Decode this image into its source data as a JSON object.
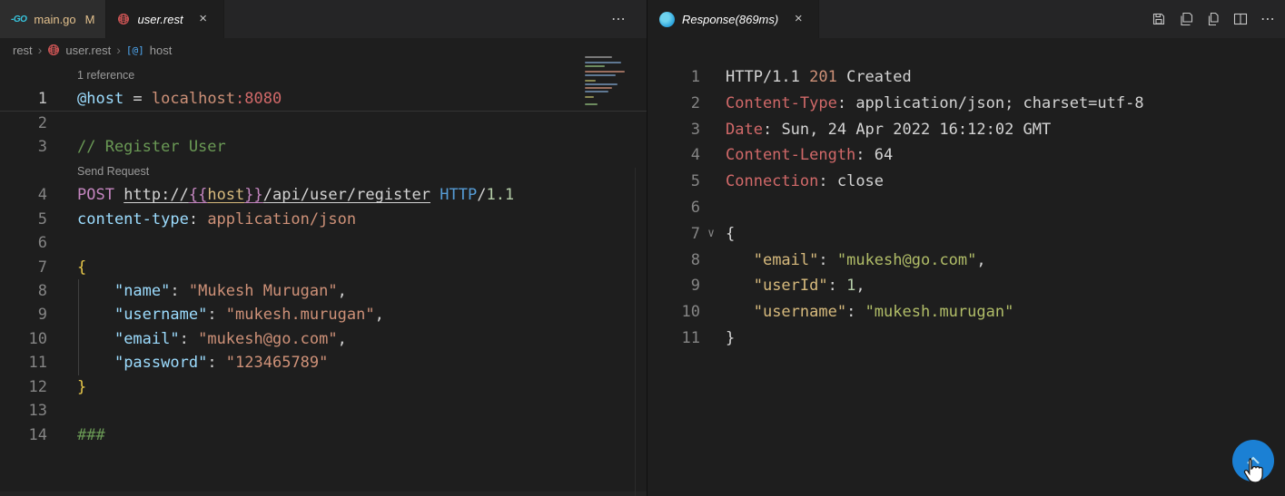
{
  "icons": {
    "go": "-GO",
    "close": "×",
    "more": "⋯",
    "fold": "∨",
    "symbol": "[@]",
    "separator": "›"
  },
  "colors": {
    "scroll_button_blue": "#1b80d4",
    "modified_tab_text": "#e2c08d",
    "globe_red": "#d05656",
    "go_cyan": "#38c7e0",
    "response_icon_blue": "#2ba3dd",
    "status_201": "#ce9178"
  },
  "left_pane": {
    "tabs": [
      {
        "label": "main.go",
        "badge": "M"
      },
      {
        "label": "user.rest"
      }
    ],
    "breadcrumb": {
      "separator": "›",
      "items": [
        {
          "label": "rest"
        },
        {
          "label": "user.rest"
        },
        {
          "label": "host"
        }
      ]
    },
    "editor_rows": [
      {
        "type": "lens",
        "text": "1 reference"
      },
      {
        "type": "code",
        "n": "1",
        "active": true,
        "seg": [
          [
            "@host",
            "blue"
          ],
          [
            " = ",
            "white"
          ],
          [
            "localhost",
            "orange"
          ],
          [
            ":8080",
            "red"
          ]
        ]
      },
      {
        "type": "code",
        "n": "2",
        "seg": []
      },
      {
        "type": "code",
        "n": "3",
        "seg": [
          [
            "// Register User",
            "green"
          ]
        ]
      },
      {
        "type": "lens",
        "text": "Send Request"
      },
      {
        "type": "code",
        "n": "4",
        "seg": [
          [
            "POST ",
            "pink"
          ],
          [
            "http://",
            "white u"
          ],
          [
            "{{",
            "pink u"
          ],
          [
            "host",
            "gold u"
          ],
          [
            "}}",
            "pink u"
          ],
          [
            "/api/user/register",
            "white u"
          ],
          [
            " ",
            "white"
          ],
          [
            "HTTP",
            "kwblue"
          ],
          [
            "/",
            "white"
          ],
          [
            "1.1",
            "lgreen"
          ]
        ]
      },
      {
        "type": "code",
        "n": "5",
        "seg": [
          [
            "content-type",
            "blue"
          ],
          [
            ": ",
            "white"
          ],
          [
            "application/json",
            "orange"
          ]
        ]
      },
      {
        "type": "code",
        "n": "6",
        "seg": []
      },
      {
        "type": "code",
        "n": "7",
        "seg": [
          [
            "{",
            "yellow"
          ]
        ]
      },
      {
        "type": "code",
        "n": "8",
        "guide": true,
        "seg": [
          [
            "    ",
            "white"
          ],
          [
            "\"name\"",
            "blue"
          ],
          [
            ": ",
            "white"
          ],
          [
            "\"Mukesh Murugan\"",
            "orange"
          ],
          [
            ",",
            "white"
          ]
        ]
      },
      {
        "type": "code",
        "n": "9",
        "guide": true,
        "seg": [
          [
            "    ",
            "white"
          ],
          [
            "\"username\"",
            "blue"
          ],
          [
            ": ",
            "white"
          ],
          [
            "\"mukesh.murugan\"",
            "orange"
          ],
          [
            ",",
            "white"
          ]
        ]
      },
      {
        "type": "code",
        "n": "10",
        "guide": true,
        "seg": [
          [
            "    ",
            "white"
          ],
          [
            "\"email\"",
            "blue"
          ],
          [
            ": ",
            "white"
          ],
          [
            "\"mukesh@go.com\"",
            "orange"
          ],
          [
            ",",
            "white"
          ]
        ]
      },
      {
        "type": "code",
        "n": "11",
        "guide": true,
        "seg": [
          [
            "    ",
            "white"
          ],
          [
            "\"password\"",
            "blue"
          ],
          [
            ": ",
            "white"
          ],
          [
            "\"123465789\"",
            "orange"
          ]
        ]
      },
      {
        "type": "code",
        "n": "12",
        "seg": [
          [
            "}",
            "yellow"
          ]
        ]
      },
      {
        "type": "code",
        "n": "13",
        "seg": []
      },
      {
        "type": "code",
        "n": "14",
        "seg": [
          [
            "###",
            "green"
          ]
        ]
      }
    ]
  },
  "right_pane": {
    "tab": {
      "label": "Response(869ms)"
    },
    "actions": [
      {
        "name": "save-response"
      },
      {
        "name": "save-response-body"
      },
      {
        "name": "copy-response"
      },
      {
        "name": "split-editor"
      },
      {
        "name": "more-actions"
      }
    ],
    "editor_rows": [
      {
        "type": "code",
        "n": "1",
        "seg": [
          [
            "HTTP/1.1 ",
            "white"
          ],
          [
            "201",
            "orange"
          ],
          [
            " Created",
            "white"
          ]
        ]
      },
      {
        "type": "code",
        "n": "2",
        "seg": [
          [
            "Content-Type",
            "red"
          ],
          [
            ": ",
            "white"
          ],
          [
            "application/json; charset=utf-8",
            "white"
          ]
        ]
      },
      {
        "type": "code",
        "n": "3",
        "seg": [
          [
            "Date",
            "red"
          ],
          [
            ": ",
            "white"
          ],
          [
            "Sun, 24 Apr 2022 16:12:02 GMT",
            "white"
          ]
        ]
      },
      {
        "type": "code",
        "n": "4",
        "seg": [
          [
            "Content-Length",
            "red"
          ],
          [
            ": ",
            "white"
          ],
          [
            "64",
            "white"
          ]
        ]
      },
      {
        "type": "code",
        "n": "5",
        "seg": [
          [
            "Connection",
            "red"
          ],
          [
            ": ",
            "white"
          ],
          [
            "close",
            "white"
          ]
        ]
      },
      {
        "type": "code",
        "n": "6",
        "seg": []
      },
      {
        "type": "code",
        "n": "7",
        "fold": true,
        "seg": [
          [
            "{",
            "white"
          ]
        ]
      },
      {
        "type": "code",
        "n": "8",
        "seg": [
          [
            "   ",
            "white"
          ],
          [
            "\"email\"",
            "gold"
          ],
          [
            ": ",
            "white"
          ],
          [
            "\"mukesh@go.com\"",
            "olive"
          ],
          [
            ",",
            "white"
          ]
        ]
      },
      {
        "type": "code",
        "n": "9",
        "seg": [
          [
            "   ",
            "white"
          ],
          [
            "\"userId\"",
            "gold"
          ],
          [
            ": ",
            "white"
          ],
          [
            "1",
            "lgreen"
          ],
          [
            ",",
            "white"
          ]
        ]
      },
      {
        "type": "code",
        "n": "10",
        "seg": [
          [
            "   ",
            "white"
          ],
          [
            "\"username\"",
            "gold"
          ],
          [
            ": ",
            "white"
          ],
          [
            "\"mukesh.murugan\"",
            "olive"
          ]
        ]
      },
      {
        "type": "code",
        "n": "11",
        "seg": [
          [
            "}",
            "white"
          ]
        ]
      }
    ]
  }
}
